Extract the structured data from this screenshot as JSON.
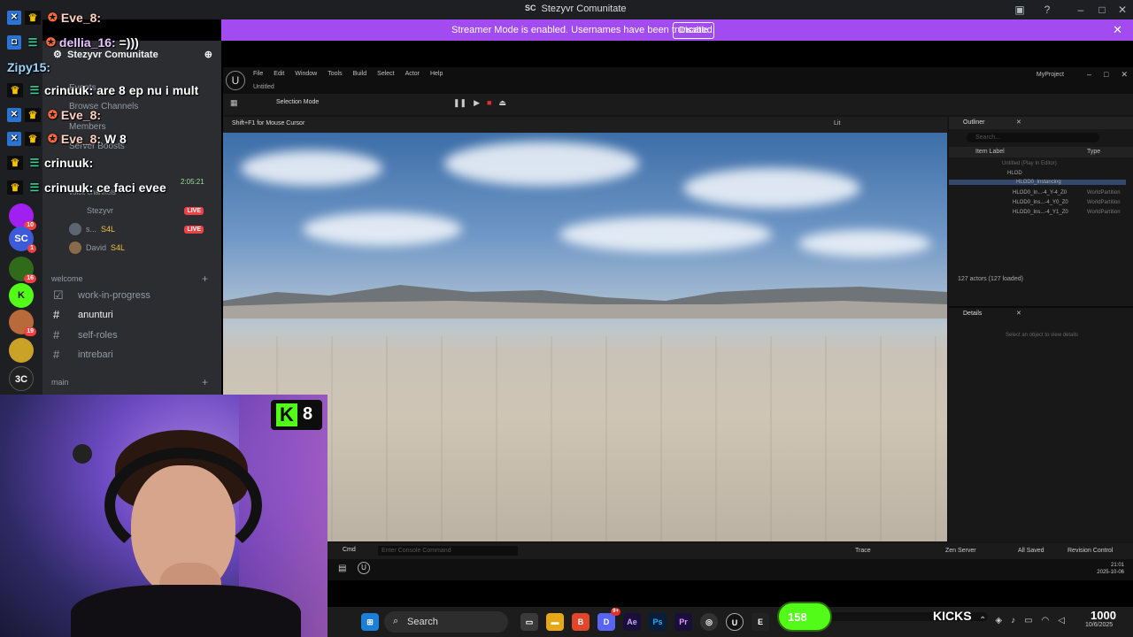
{
  "discord": {
    "window_title": "Stezyvr Comunitate",
    "title_icon": "SC",
    "banner": {
      "text": "Streamer Mode is enabled. Usernames have been truncated.",
      "button": "Disable"
    },
    "server_name": "Stezyvr Comunitate",
    "menu_items": [
      "Events",
      "Browse Channels",
      "Members",
      "Server Boosts"
    ],
    "voice_section": "voice channels",
    "voice_users": [
      {
        "name": "Stezyvr",
        "badge": "LIVE"
      },
      {
        "name": "s...",
        "badge": "LIVE",
        "tag": "S4L"
      },
      {
        "name": "David",
        "tag": "S4L"
      }
    ],
    "categories": [
      {
        "name": "welcome",
        "channels": [
          {
            "name": "work-in-progress",
            "icon": "checkbox-icon"
          },
          {
            "name": "anunturi",
            "icon": "hash-icon"
          },
          {
            "name": "self-roles",
            "icon": "hash-icon"
          },
          {
            "name": "intrebari",
            "icon": "hash-icon"
          }
        ]
      },
      {
        "name": "main",
        "channels": []
      }
    ],
    "server_badges": [
      "10",
      "1",
      "16",
      "19"
    ]
  },
  "chat": [
    {
      "user": "Eve_8:",
      "text": ""
    },
    {
      "user": "dellia_16:",
      "text": "=)))"
    },
    {
      "user": "Zipy15:",
      "text": ""
    },
    {
      "user": "crinuuk:",
      "text": "are 8 ep nu i mult"
    },
    {
      "user": "Eve_8:",
      "text": ""
    },
    {
      "user": "Eve_8:",
      "text": "W 8"
    },
    {
      "user": "crinuuk:",
      "text": ""
    },
    {
      "user": "crinuuk:",
      "text": "ce faci evee"
    }
  ],
  "chat_timestamp": "2:05:21",
  "unreal": {
    "menu": [
      "File",
      "Edit",
      "Window",
      "Tools",
      "Build",
      "Select",
      "Actor",
      "Help"
    ],
    "tab": "Untitled",
    "project": "MyProject",
    "mode": "Selection Mode",
    "viewport_hint": "Shift+F1 for Mouse Cursor",
    "lit": "Lit",
    "outliner": {
      "title": "Outliner",
      "search_placeholder": "Search...",
      "col_label": "Item Label",
      "col_type": "Type",
      "rows": [
        {
          "label": "Untitled (Play In Editor)",
          "type": ""
        },
        {
          "label": "HLOD",
          "type": ""
        },
        {
          "label": "HLOD0_Instancing",
          "type": ""
        },
        {
          "label": "HLOD0_In...-4_Y-4_Z0",
          "type": "WorldPartition"
        },
        {
          "label": "HLOD0_Ins...-4_Y0_Z0",
          "type": "WorldPartition"
        },
        {
          "label": "HLOD0_Ins...-4_Y1_Z0",
          "type": "WorldPartition"
        }
      ],
      "count": "127 actors (127 loaded)"
    },
    "details": {
      "title": "Details",
      "hint": "Select an object to view details"
    },
    "bottom": {
      "cmd": "Cmd",
      "console_placeholder": "Enter Console Command",
      "trace": "Trace",
      "zen": "Zen Server",
      "saved": "All Saved",
      "revision": "Revision Control"
    },
    "clock_time": "21:01",
    "clock_date": "2025-10-06"
  },
  "kick_badge": {
    "count": "8"
  },
  "taskbar": {
    "search_placeholder": "Search",
    "apps": [
      "start-icon",
      "task-view-icon",
      "explorer-icon",
      "brave-icon",
      "discord-icon",
      "after-effects-icon",
      "photoshop-icon",
      "premiere-icon",
      "obs-icon",
      "unreal-icon",
      "epic-icon"
    ],
    "discord_badge": "9+"
  },
  "kicks_widget": {
    "current": "158",
    "label": "KICKS",
    "goal": "1000",
    "progress": 0.158
  },
  "clock": {
    "time": "",
    "date": "10/6/2025"
  }
}
